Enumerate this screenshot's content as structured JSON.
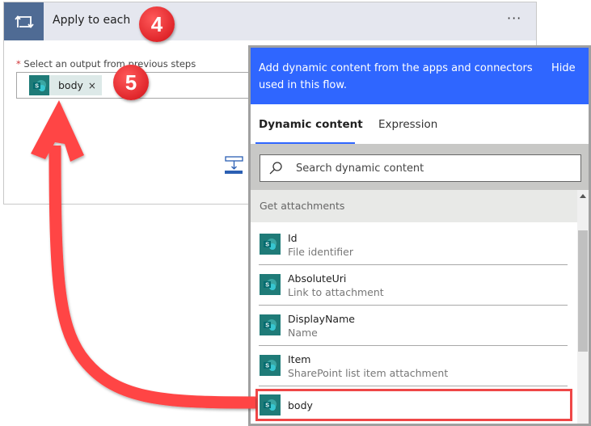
{
  "card": {
    "title": "Apply to each",
    "more_label": "···",
    "icon": "loop-icon",
    "field_label_required": "*",
    "field_label": "Select an output from previous steps",
    "token": {
      "label": "body",
      "close": "×",
      "icon": "sharepoint-icon"
    },
    "insert_icon": "insert-step-icon"
  },
  "panel": {
    "banner_text": "Add dynamic content from the apps and connectors used in this flow.",
    "hide_label": "Hide",
    "tabs": [
      {
        "label": "Dynamic content",
        "active": true
      },
      {
        "label": "Expression",
        "active": false
      }
    ],
    "search": {
      "placeholder": "Search dynamic content",
      "icon": "search-icon"
    },
    "section_title": "Get attachments",
    "items": [
      {
        "name": "Id",
        "description": "File identifier",
        "icon": "sharepoint-icon"
      },
      {
        "name": "AbsoluteUri",
        "description": "Link to attachment",
        "icon": "sharepoint-icon"
      },
      {
        "name": "DisplayName",
        "description": "Name",
        "icon": "sharepoint-icon"
      },
      {
        "name": "Item",
        "description": "SharePoint list item attachment",
        "icon": "sharepoint-icon"
      },
      {
        "name": "body",
        "description": "",
        "icon": "sharepoint-icon",
        "highlighted": true
      }
    ]
  },
  "annotations": {
    "step_badges": [
      "4",
      "5"
    ],
    "arrow_color": "#ff4545",
    "highlight_color": "#ef4747"
  },
  "colors": {
    "banner_blue": "#2f66ff",
    "sharepoint_teal": "#1f7b78",
    "header_slate": "#4f6b94"
  }
}
